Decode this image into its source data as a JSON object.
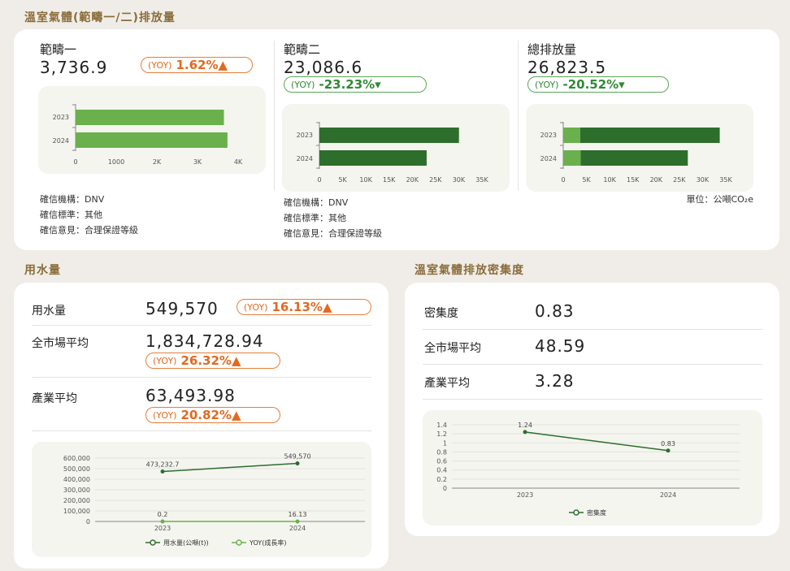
{
  "ghg": {
    "title": "溫室氣體(範疇一/二)排放量",
    "unit": "單位：公噸CO₂e",
    "scopes": [
      {
        "name": "範疇一",
        "value": "3,736.9",
        "yoy_label": "(YOY)",
        "yoy": "1.62%▲",
        "trend": "up",
        "info": [
          "確信機構：DNV",
          "確信標準：其他",
          "確信意見：合理保證等級"
        ]
      },
      {
        "name": "範疇二",
        "value": "23,086.6",
        "yoy_label": "(YOY)",
        "yoy": "-23.23%▾",
        "trend": "down",
        "info": [
          "確信機構：DNV",
          "確信標準：其他",
          "確信意見：合理保證等級"
        ]
      },
      {
        "name": "總排放量",
        "value": "26,823.5",
        "yoy_label": "(YOY)",
        "yoy": "-20.52%▾",
        "trend": "down",
        "info": []
      }
    ]
  },
  "water": {
    "title": "用水量",
    "rows": [
      {
        "label": "用水量",
        "value": "549,570",
        "yoy_label": "(YOY)",
        "yoy": "16.13%▲"
      },
      {
        "label": "全市場平均",
        "value": "1,834,728.94",
        "yoy_label": "(YOY)",
        "yoy": "26.32%▲"
      },
      {
        "label": "產業平均",
        "value": "63,493.98",
        "yoy_label": "(YOY)",
        "yoy": "20.82%▲"
      }
    ]
  },
  "density": {
    "title": "溫室氣體排放密集度",
    "rows": [
      {
        "label": "密集度",
        "value": "0.83"
      },
      {
        "label": "全市場平均",
        "value": "48.59"
      },
      {
        "label": "產業平均",
        "value": "3.28"
      }
    ]
  },
  "colors": {
    "accent_orange": "#e2691e",
    "green_dark": "#2d6e2d",
    "green_light": "#6ab04c",
    "title_brown": "#8a6d3b"
  },
  "chart_data": [
    {
      "type": "bar",
      "orientation": "horizontal",
      "categories": [
        "2023",
        "2024"
      ],
      "series": [
        {
          "values": [
            3650,
            3736.9
          ]
        }
      ],
      "xlim": [
        0,
        4000
      ],
      "xticks": [
        "0",
        "1000",
        "2K",
        "3K",
        "4K"
      ]
    },
    {
      "type": "bar",
      "orientation": "horizontal",
      "categories": [
        "2023",
        "2024"
      ],
      "series": [
        {
          "values": [
            30050,
            23086.6
          ]
        }
      ],
      "xlim": [
        0,
        35000
      ],
      "xticks": [
        "0",
        "5K",
        "10K",
        "15K",
        "20K",
        "25K",
        "30K",
        "35K"
      ]
    },
    {
      "type": "bar",
      "orientation": "horizontal",
      "stacked": true,
      "categories": [
        "2023",
        "2024"
      ],
      "series": [
        {
          "values": [
            3650,
            3736.9
          ]
        },
        {
          "values": [
            30050,
            23086.6
          ]
        }
      ],
      "xlim": [
        0,
        35000
      ],
      "xticks": [
        "0",
        "5K",
        "10K",
        "15K",
        "20K",
        "25K",
        "30K",
        "35K"
      ]
    },
    {
      "type": "line",
      "x": [
        "2023",
        "2024"
      ],
      "series": [
        {
          "name": "用水量(公噸(t))",
          "values": [
            473232.7,
            549570
          ],
          "labels": [
            "473,232.7",
            "549,570"
          ]
        },
        {
          "name": "YOY(成長率)",
          "values": [
            0.2,
            16.13
          ],
          "labels": [
            "0.2",
            "16.13"
          ]
        }
      ],
      "ylim": [
        0,
        600000
      ],
      "yticks": [
        "0",
        "100,000",
        "200,000",
        "300,000",
        "400,000",
        "500,000",
        "600,000"
      ],
      "legend": "bottom"
    },
    {
      "type": "line",
      "x": [
        "2023",
        "2024"
      ],
      "series": [
        {
          "name": "密集度",
          "values": [
            1.24,
            0.83
          ],
          "labels": [
            "1.24",
            "0.83"
          ]
        }
      ],
      "ylim": [
        0,
        1.4
      ],
      "yticks": [
        "0",
        "0.2",
        "0.4",
        "0.6",
        "0.8",
        "1",
        "1.2",
        "1.4"
      ],
      "legend": "bottom"
    }
  ]
}
